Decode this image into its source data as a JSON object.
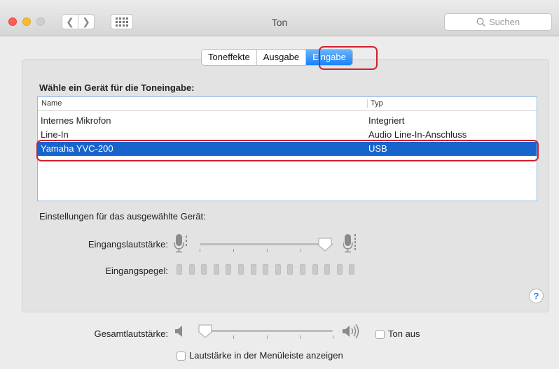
{
  "window": {
    "title": "Ton"
  },
  "toolbar": {
    "search_placeholder": "Suchen"
  },
  "tabs": [
    {
      "label": "Toneffekte",
      "active": false
    },
    {
      "label": "Ausgabe",
      "active": false
    },
    {
      "label": "Eingabe",
      "active": true
    }
  ],
  "input": {
    "choose_label": "Wähle ein Gerät für die Toneingabe:",
    "columns": {
      "name": "Name",
      "type": "Typ"
    },
    "devices": [
      {
        "name": "Internes Mikrofon",
        "type": "Integriert",
        "selected": false
      },
      {
        "name": "Line-In",
        "type": "Audio Line-In-Anschluss",
        "selected": false
      },
      {
        "name": "Yamaha YVC-200",
        "type": "USB",
        "selected": true
      }
    ],
    "settings_label": "Einstellungen für das ausgewählte Gerät:",
    "input_volume_label": "Eingangslautstärke:",
    "input_volume_level": 0.94,
    "input_level_label": "Eingangspegel:",
    "input_level_segments": 15,
    "input_level_active": 0
  },
  "output": {
    "volume_label": "Gesamtlautstärke:",
    "volume_level": 0.04,
    "mute_label": "Ton aus",
    "mute_checked": false,
    "menubar_label": "Lautstärke in der Menüleiste anzeigen",
    "menubar_checked": false
  },
  "colors": {
    "accent": "#1a82fb",
    "selection": "#1864cd",
    "highlight_annotation": "#d0202f"
  }
}
